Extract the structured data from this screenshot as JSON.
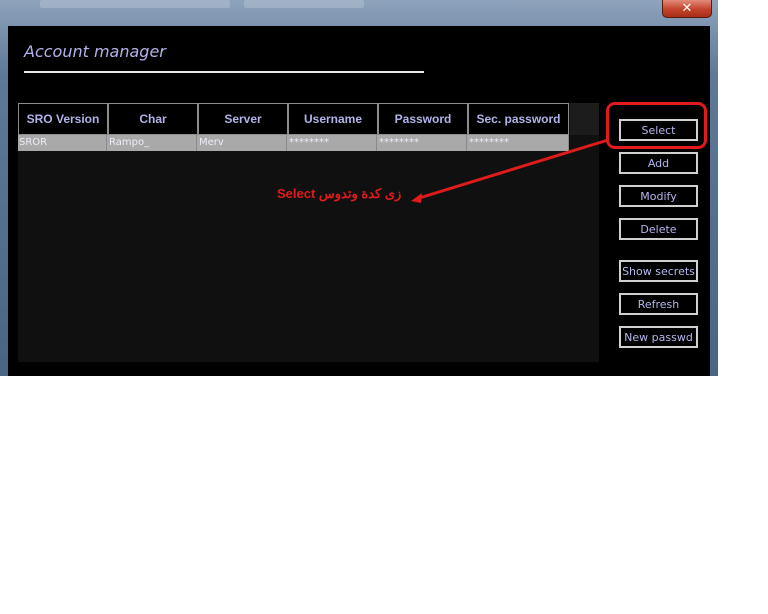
{
  "window": {
    "close_glyph": "✕"
  },
  "heading": "Account manager",
  "table": {
    "columns": [
      "SRO Version",
      "Char",
      "Server",
      "Username",
      "Password",
      "Sec. password"
    ],
    "rows": [
      [
        "SROR",
        "Rampo_",
        "Merv",
        "********",
        "********",
        "********"
      ]
    ]
  },
  "buttons": {
    "select": "Select",
    "add": "Add",
    "modify": "Modify",
    "delete": "Delete",
    "show_secrets": "Show secrets",
    "refresh": "Refresh",
    "new_passwd": "New passwd"
  },
  "annotation": {
    "text": "زى كدة وتدوس Select",
    "color": "#e01b1b"
  }
}
